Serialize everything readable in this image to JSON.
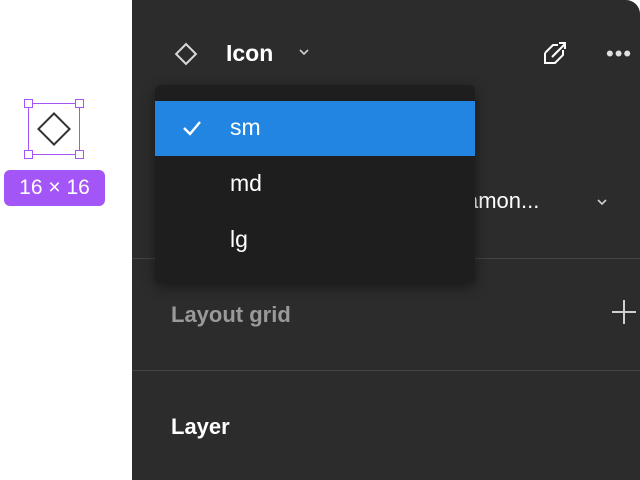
{
  "canvas": {
    "selection_size_label": "16 × 16",
    "selection_color": "#a455f7"
  },
  "panel": {
    "header": {
      "component_icon": "diamond-outline-icon",
      "title": "Icon",
      "chevron_icon": "chevron-down-icon",
      "detach_icon": "detach-instance-icon",
      "more_icon": "more-horizontal-icon"
    },
    "variant": {
      "value": "amon...",
      "chevron_icon": "chevron-down-icon"
    },
    "layout_grid": {
      "title": "Layout grid",
      "add_icon": "plus-icon"
    },
    "layer": {
      "title": "Layer"
    }
  },
  "dropdown": {
    "items": [
      {
        "label": "sm",
        "selected": true,
        "icon": "checkmark-icon"
      },
      {
        "label": "md",
        "selected": false
      },
      {
        "label": "lg",
        "selected": false
      }
    ],
    "accent": "#2385e2"
  }
}
